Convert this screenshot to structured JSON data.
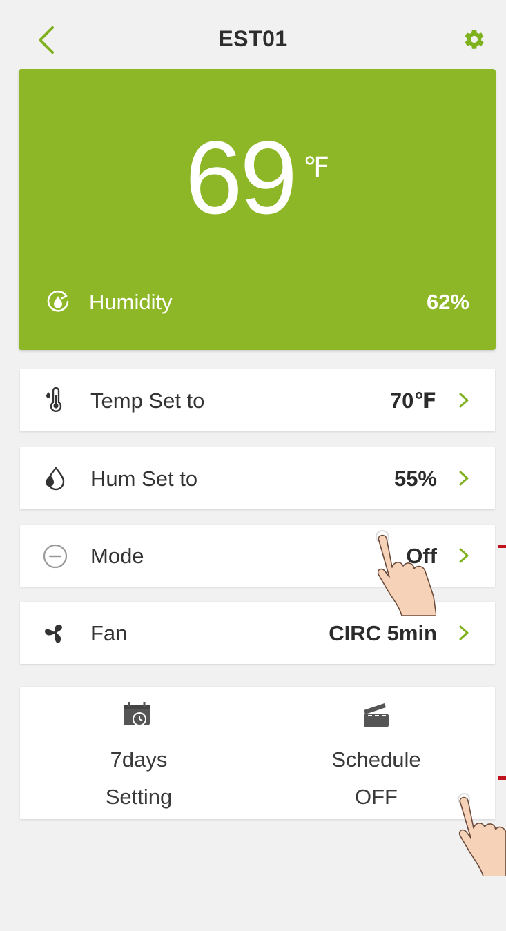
{
  "header": {
    "title": "EST01",
    "back_icon": "chevron-left-icon",
    "settings_icon": "gear-icon",
    "accent_color": "#7fb01e"
  },
  "hero": {
    "background_color": "#8db726",
    "temperature": "69",
    "unit": "℉",
    "humidity_icon": "humidity-drop-icon",
    "humidity_label": "Humidity",
    "humidity_value": "62%"
  },
  "settings_rows": [
    {
      "icon": "thermometer-icon",
      "label": "Temp Set to",
      "value": "70℉"
    },
    {
      "icon": "water-drops-icon",
      "label": "Hum Set to",
      "value": "55%"
    },
    {
      "icon": "minus-circle-icon",
      "label": "Mode",
      "value": "Off"
    },
    {
      "icon": "fan-icon",
      "label": "Fan",
      "value": "CIRC 5min"
    }
  ],
  "bottom_tiles": [
    {
      "icon": "calendar-clock-icon",
      "line1": "7days",
      "line2": "Setting"
    },
    {
      "icon": "clapperboard-icon",
      "line1": "Schedule",
      "line2": "OFF"
    }
  ],
  "annotation": {
    "marker_color": "#c0121c",
    "pointer_icon": "tapping-hand-icon"
  }
}
